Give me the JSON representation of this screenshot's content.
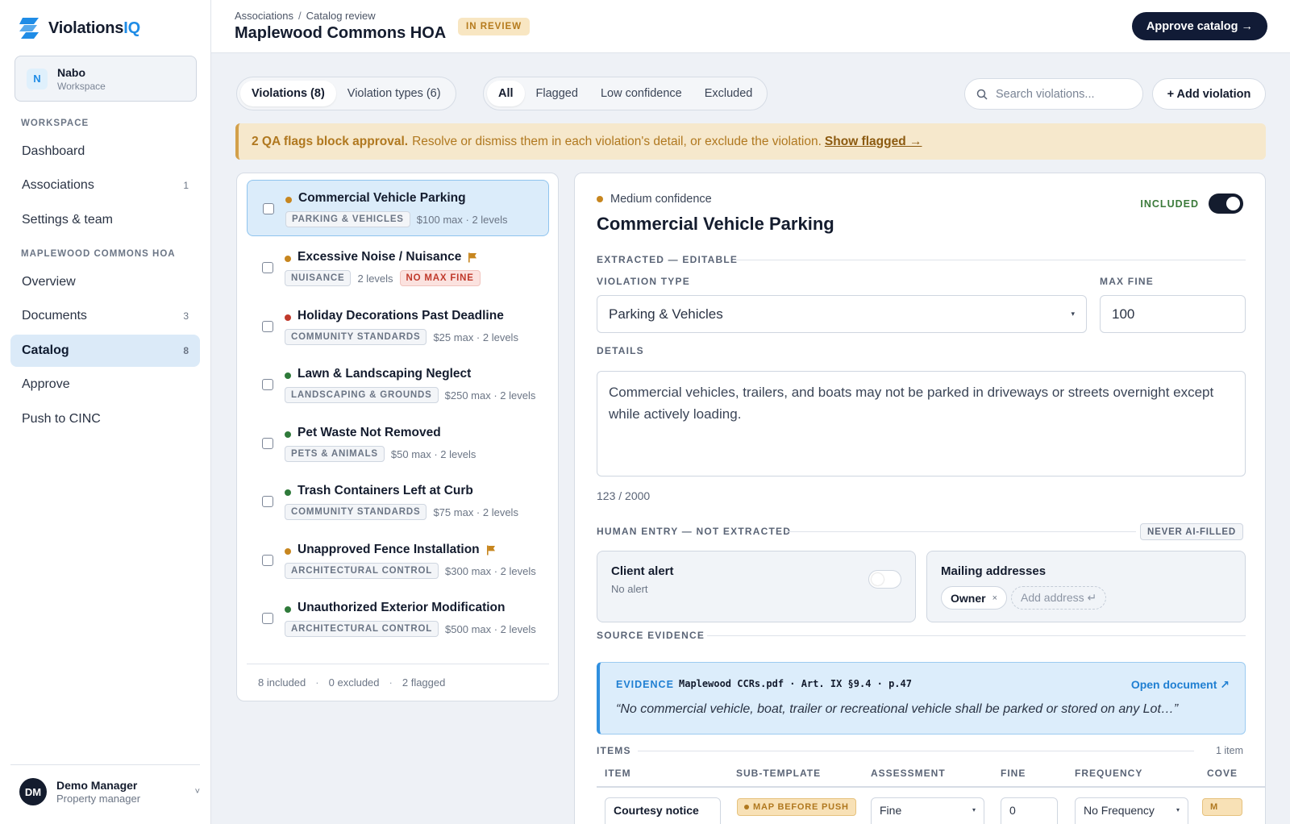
{
  "app": {
    "logo_main": "Violations",
    "logo_accent": "IQ"
  },
  "workspace": {
    "initial": "N",
    "name": "Nabo",
    "sub": "Workspace"
  },
  "nav": {
    "section_workspace": "WORKSPACE",
    "items_workspace": [
      {
        "label": "Dashboard",
        "count": ""
      },
      {
        "label": "Associations",
        "count": "1"
      },
      {
        "label": "Settings & team",
        "count": ""
      }
    ],
    "section_hoa": "MAPLEWOOD COMMONS HOA",
    "items_hoa": [
      {
        "label": "Overview",
        "count": ""
      },
      {
        "label": "Documents",
        "count": "3"
      },
      {
        "label": "Catalog",
        "count": "8",
        "active": true
      },
      {
        "label": "Approve",
        "count": ""
      },
      {
        "label": "Push to CINC",
        "count": ""
      }
    ]
  },
  "user": {
    "initials": "DM",
    "name": "Demo Manager",
    "role": "Property manager",
    "chevron": "˅"
  },
  "header": {
    "breadcrumb": [
      "Associations",
      "Catalog review"
    ],
    "breadcrumb_sep": "/",
    "title": "Maplewood Commons HOA",
    "status": "IN REVIEW",
    "approve_label": "Approve catalog →"
  },
  "toolbar": {
    "view_tabs": [
      "Violations (8)",
      "Violation types (6)"
    ],
    "filters": [
      "All",
      "Flagged",
      "Low confidence",
      "Excluded"
    ],
    "search_placeholder": "Search violations...",
    "add_label": "+ Add violation"
  },
  "banner": {
    "bold": "2 QA flags block approval.",
    "text": "Resolve or dismiss them in each violation's detail, or exclude the violation.",
    "link": "Show flagged →"
  },
  "violations": [
    {
      "title": "Commercial Vehicle Parking",
      "confidence": "medium",
      "flagged": false,
      "tag": "PARKING & VEHICLES",
      "meta": "$100 max · 2 levels",
      "warn": ""
    },
    {
      "title": "Excessive Noise / Nuisance",
      "confidence": "medium",
      "flagged": true,
      "tag": "NUISANCE",
      "meta": "2 levels",
      "warn": "NO MAX FINE"
    },
    {
      "title": "Holiday Decorations Past Deadline",
      "confidence": "low",
      "flagged": false,
      "tag": "COMMUNITY STANDARDS",
      "meta": "$25 max · 2 levels",
      "warn": ""
    },
    {
      "title": "Lawn & Landscaping Neglect",
      "confidence": "high",
      "flagged": false,
      "tag": "LANDSCAPING & GROUNDS",
      "meta": "$250 max · 2 levels",
      "warn": ""
    },
    {
      "title": "Pet Waste Not Removed",
      "confidence": "high",
      "flagged": false,
      "tag": "PETS & ANIMALS",
      "meta": "$50 max · 2 levels",
      "warn": ""
    },
    {
      "title": "Trash Containers Left at Curb",
      "confidence": "high",
      "flagged": false,
      "tag": "COMMUNITY STANDARDS",
      "meta": "$75 max · 2 levels",
      "warn": ""
    },
    {
      "title": "Unapproved Fence Installation",
      "confidence": "medium",
      "flagged": true,
      "tag": "ARCHITECTURAL CONTROL",
      "meta": "$300 max · 2 levels",
      "warn": ""
    },
    {
      "title": "Unauthorized Exterior Modification",
      "confidence": "high",
      "flagged": false,
      "tag": "ARCHITECTURAL CONTROL",
      "meta": "$500 max · 2 levels",
      "warn": ""
    }
  ],
  "list_footer": {
    "included": "8 included",
    "excluded": "0 excluded",
    "flagged": "2 flagged",
    "sep": "·"
  },
  "detail": {
    "confidence": "Medium confidence",
    "title": "Commercial Vehicle Parking",
    "included_label": "INCLUDED",
    "section_extracted": "EXTRACTED — EDITABLE",
    "violation_type_label": "VIOLATION TYPE",
    "violation_type_value": "Parking & Vehicles",
    "max_fine_label": "MAX FINE",
    "max_fine_value": "100",
    "details_label": "DETAILS",
    "details_value": "Commercial vehicles, trailers, and boats may not be parked in driveways or streets overnight except while actively loading.",
    "char_count": "123 / 2000",
    "section_human": "HUMAN ENTRY — NOT EXTRACTED",
    "never_ai": "NEVER AI-FILLED",
    "client_alert_title": "Client alert",
    "client_alert_sub": "No alert",
    "mailing_title": "Mailing addresses",
    "mailing_chip": "Owner",
    "mailing_chip_x": "×",
    "mailing_add": "Add address ↵",
    "section_source": "SOURCE EVIDENCE",
    "evidence_label": "EVIDENCE",
    "evidence_source": "Maplewood CCRs.pdf · Art. IX §9.4 · p.47",
    "evidence_open": "Open document ↗",
    "evidence_quote": "“No commercial vehicle, boat, trailer or recreational vehicle shall be parked or stored on any Lot…”",
    "section_items": "ITEMS",
    "items_count": "1 item",
    "columns": [
      "ITEM",
      "SUB-TEMPLATE",
      "ASSESSMENT",
      "FINE",
      "FREQUENCY",
      "COVE"
    ],
    "row": {
      "item": "Courtesy notice",
      "subtemplate": "MAP BEFORE PUSH",
      "assessment": "Fine",
      "fine": "0",
      "frequency": "No Frequency",
      "cove": "M"
    }
  },
  "colors": {
    "high": "#2f7a3a",
    "medium": "#c7861f",
    "low": "#c0392b",
    "flag": "#c7861f",
    "accent": "#1f8ce6"
  }
}
